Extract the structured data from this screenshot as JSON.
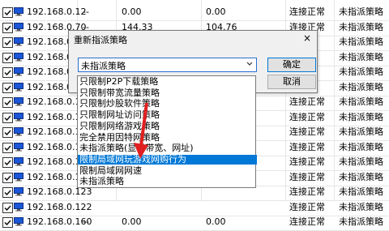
{
  "table": {
    "rows": [
      {
        "ip": "192.168.0.12",
        "col2": "--",
        "up": "0.00",
        "down": "0.00",
        "status": "连接正常",
        "policy": "未指派策略",
        "pc_color": "#1a56d6"
      },
      {
        "ip": "192.168.0.70",
        "col2": "--",
        "up": "144.33",
        "down": "104.76",
        "status": "连接正常",
        "policy": "未指派策略",
        "pc_color": "#1a56d6"
      },
      {
        "ip": "192.168.0.10",
        "col2": "",
        "up": "",
        "down": "",
        "status": "",
        "policy": "未指派策略",
        "pc_color": "#1a56d6"
      },
      {
        "ip": "192.168.0.10",
        "col2": "",
        "up": "",
        "down": "",
        "status": "",
        "policy": "未指派策略",
        "pc_color": "#1a56d6"
      },
      {
        "ip": "192.168.0.11",
        "col2": "",
        "up": "",
        "down": "",
        "status": "",
        "policy": "未指派策略",
        "pc_color": "#1a56d6"
      },
      {
        "ip": "192.168.0.11",
        "col2": "",
        "up": "",
        "down": "",
        "status": "",
        "policy": "未指派策略",
        "pc_color": "#1a56d6"
      },
      {
        "ip": "192.168.0.11",
        "col2": "",
        "up": "",
        "down": "",
        "status": "连接正常",
        "policy": "未指派策略",
        "pc_color": "#1a56d6"
      },
      {
        "ip": "192.168.0.118",
        "col2": "",
        "up": "",
        "down": "",
        "status": "连接正常",
        "policy": "未指派策略",
        "pc_color": "#1a56d6"
      },
      {
        "ip": "192.168.0.198",
        "col2": "",
        "up": "",
        "down": "",
        "status": "连接正常",
        "policy": "未指派策略",
        "pc_color": "#1a56d6"
      },
      {
        "ip": "192.168.0.130",
        "col2": "",
        "up": "",
        "down": "",
        "status": "连接正常",
        "policy": "未指派策略",
        "pc_color": "#1a56d6"
      },
      {
        "ip": "192.168.0.182",
        "col2": "",
        "up": "",
        "down": "",
        "status": "连接正常",
        "policy": "未指派策略",
        "pc_color": "#1a56d6"
      },
      {
        "ip": "192.168.0.177",
        "col2": "",
        "up": "",
        "down": "",
        "status": "连接正常",
        "policy": "未指派策略",
        "pc_color": "#1a56d6"
      },
      {
        "ip": "192.168.0.123",
        "col2": "",
        "up": "",
        "down": "",
        "status": "连接正常",
        "policy": "未指派策略",
        "pc_color": "#1a56d6"
      },
      {
        "ip": "192.168.0.122",
        "col2": "",
        "up": "",
        "down": "",
        "status": "连接正常",
        "policy": "未指派策略",
        "pc_color": "#1a56d6"
      },
      {
        "ip": "192.168.0.160",
        "col2": "--",
        "up": "0.00",
        "down": "0.00",
        "status": "连接正常",
        "policy": "未指派策略",
        "pc_color": "#1a56d6"
      }
    ]
  },
  "dialog": {
    "title": "重新指派策略",
    "close": "×",
    "combo_value": "未指派策略",
    "ok_label": "确定",
    "cancel_label": "取消"
  },
  "dropdown": {
    "options": [
      "只限制P2P下载策略",
      "只限制带宽流量策略",
      "只限制炒股软件策略",
      "只限制网址访问策略",
      "只限制网络游戏策略",
      "完全禁用因特网策略",
      "未指派策略(显示带宽、网址)",
      "限制局域网玩游戏网购行为",
      "限制局域网网速",
      "未指派策略"
    ],
    "selected_index": 7
  },
  "colors": {
    "selection": "#0078d7",
    "arrow": "#e02020",
    "pc_icon": "#1a56d6"
  }
}
